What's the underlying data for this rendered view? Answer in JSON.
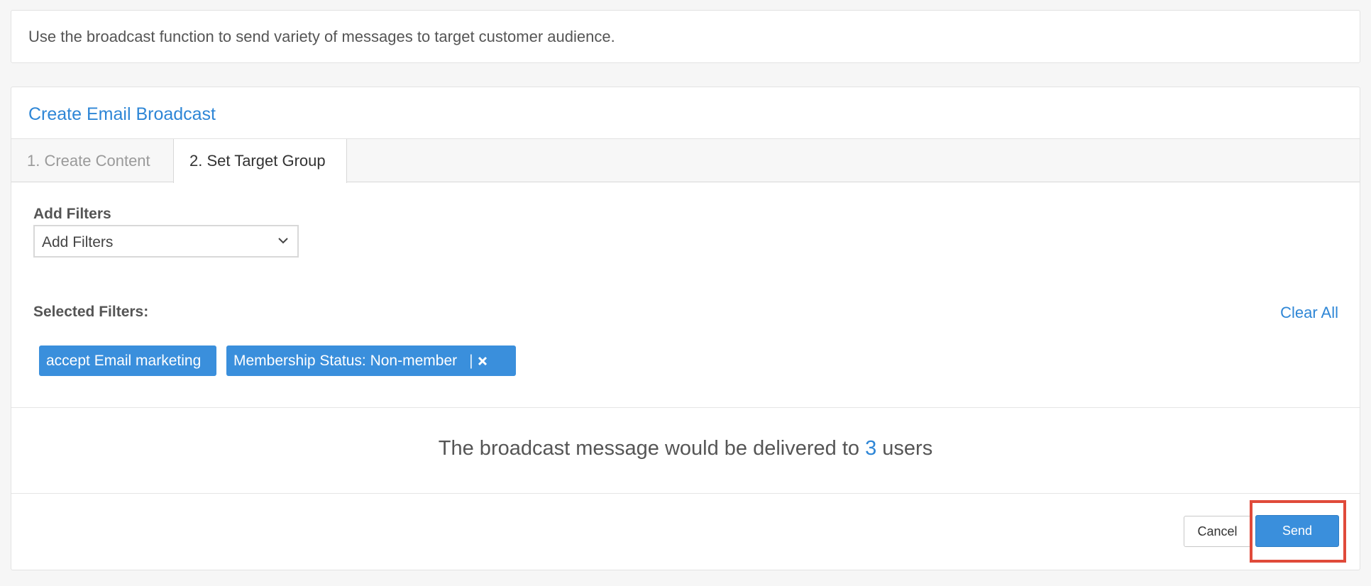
{
  "info": {
    "text": "Use the broadcast function to send variety of messages to target customer audience."
  },
  "panel": {
    "title": "Create Email Broadcast",
    "tabs": [
      {
        "label": "1. Create Content",
        "active": false
      },
      {
        "label": "2. Set Target Group",
        "active": true
      }
    ]
  },
  "filters": {
    "label": "Add Filters",
    "dropdown_value": "Add Filters",
    "selected_label": "Selected Filters:",
    "clear_all": "Clear All",
    "chips": [
      {
        "label": "accept Email marketing"
      },
      {
        "label": "Membership Status: Non-member",
        "separator": "|"
      }
    ]
  },
  "delivery": {
    "prefix": "The broadcast message would be delivered to",
    "count": "3",
    "suffix": "users"
  },
  "actions": {
    "cancel": "Cancel",
    "send": "Send"
  },
  "colors": {
    "accent": "#3a8fdc",
    "link": "#2e86d6",
    "highlight": "#e04a3a"
  }
}
